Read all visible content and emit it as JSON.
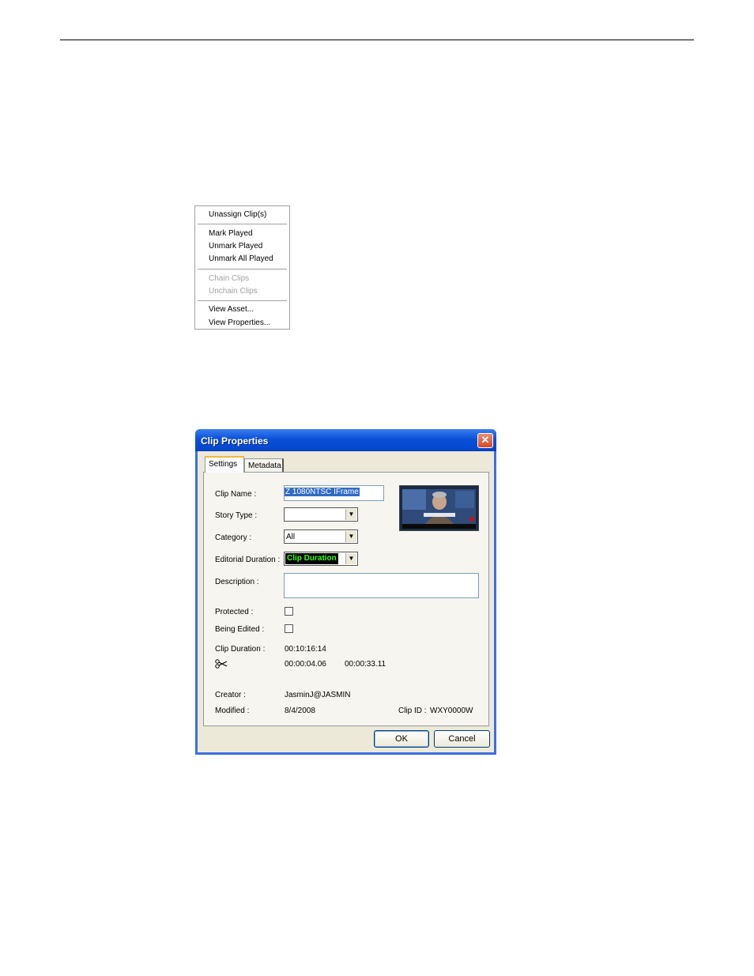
{
  "context_menu": {
    "items": [
      {
        "label": "Unassign Clip(s)",
        "enabled": true
      },
      {
        "label": "Mark Played",
        "enabled": true
      },
      {
        "label": "Unmark Played",
        "enabled": true
      },
      {
        "label": "Unmark All Played",
        "enabled": true
      },
      {
        "label": "Chain Clips",
        "enabled": false
      },
      {
        "label": "Unchain Clips",
        "enabled": false
      },
      {
        "label": "View Asset...",
        "enabled": true
      },
      {
        "label": "View Properties...",
        "enabled": true
      }
    ]
  },
  "dialog": {
    "title": "Clip Properties",
    "close_glyph": "✕",
    "tabs": [
      {
        "label": "Settings",
        "active": true
      },
      {
        "label": "Metadata",
        "active": false
      }
    ],
    "fields": {
      "clip_name_label": "Clip Name :",
      "clip_name_value": "Z 1080NTSC IFrame",
      "story_type_label": "Story Type :",
      "story_type_value": "",
      "category_label": "Category :",
      "category_value": "All",
      "editorial_duration_label": "Editorial Duration :",
      "editorial_duration_value": "Clip Duration",
      "description_label": "Description :",
      "description_value": "",
      "protected_label": "Protected :",
      "protected_checked": false,
      "being_edited_label": "Being Edited :",
      "being_edited_checked": false,
      "clip_duration_label": "Clip Duration :",
      "clip_duration_value": "00:10:16:14",
      "mark_in_value": "00:00:04.06",
      "mark_out_value": "00:00:33.11",
      "scissors_icon": "scissors-icon",
      "creator_label": "Creator :",
      "creator_value": "JasminJ@JASMIN",
      "modified_label": "Modified :",
      "modified_value": "8/4/2008",
      "clip_id_label": "Clip ID :",
      "clip_id_value": "WXY0000W"
    },
    "buttons": {
      "ok_label": "OK",
      "cancel_label": "Cancel"
    },
    "colors": {
      "title_bar": "#0a4fd6",
      "close_button": "#d44a25",
      "selection": "#316ac5",
      "duration_text": "#39ff14"
    }
  }
}
